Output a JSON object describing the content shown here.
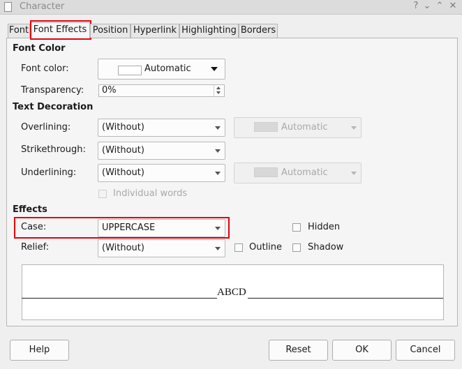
{
  "window": {
    "title": "Character",
    "controls": [
      "?",
      "⌄",
      "⌃",
      "✕"
    ]
  },
  "tabs": [
    "Font",
    "Font Effects",
    "Position",
    "Hyperlink",
    "Highlighting",
    "Borders"
  ],
  "active_tab": "Font Effects",
  "font_color": {
    "heading": "Font Color",
    "label": "Font color:",
    "value": "Automatic",
    "transparency_label": "Transparency:",
    "transparency_value": "0%"
  },
  "text_decoration": {
    "heading": "Text Decoration",
    "overlining_label": "Overlining:",
    "overlining_value": "(Without)",
    "overline_color": "Automatic",
    "strikethrough_label": "Strikethrough:",
    "strikethrough_value": "(Without)",
    "underlining_label": "Underlining:",
    "underlining_value": "(Without)",
    "underline_color": "Automatic",
    "individual_words": "Individual words"
  },
  "effects": {
    "heading": "Effects",
    "case_label": "Case:",
    "case_value": "UPPERCASE",
    "relief_label": "Relief:",
    "relief_value": "(Without)",
    "hidden": "Hidden",
    "outline": "Outline",
    "shadow": "Shadow"
  },
  "preview": {
    "text": "ABCD"
  },
  "buttons": {
    "help": "Help",
    "reset": "Reset",
    "ok": "OK",
    "cancel": "Cancel"
  },
  "colors": {
    "highlight": "#e8000b"
  }
}
